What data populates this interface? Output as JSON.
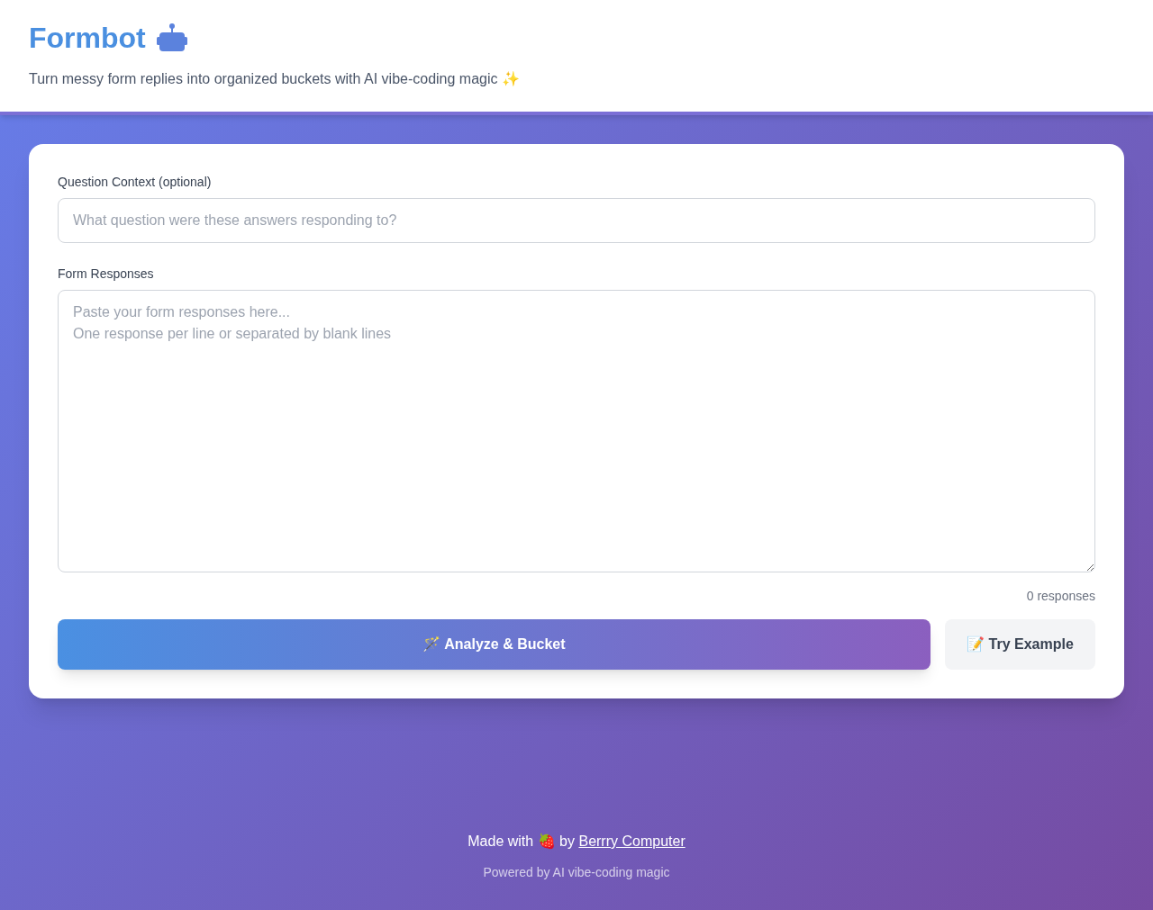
{
  "header": {
    "title": "Formbot",
    "subtitle": "Turn messy form replies into organized buckets with AI vibe-coding magic ✨"
  },
  "form": {
    "context_label": "Question Context (optional)",
    "context_placeholder": "What question were these answers responding to?",
    "responses_label": "Form Responses",
    "responses_placeholder": "Paste your form responses here...\nOne response per line or separated by blank lines",
    "count": "0 responses",
    "primary_button": "🪄 Analyze & Bucket",
    "secondary_button": "📝 Try Example"
  },
  "footer": {
    "made_with": "Made with 🍓 by",
    "link": "Berrry Computer",
    "powered": "Powered by AI vibe-coding magic"
  }
}
